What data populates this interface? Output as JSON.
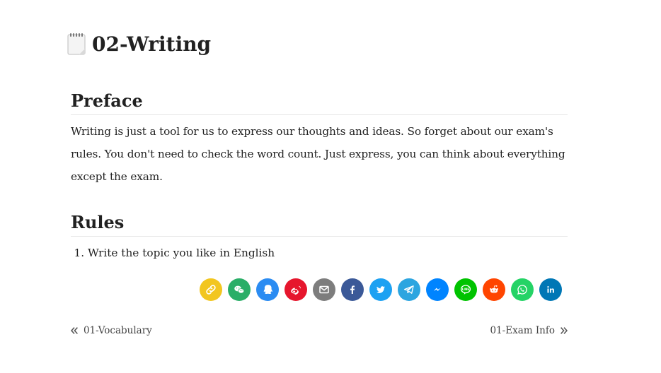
{
  "page": {
    "title": "02-Writing",
    "title_icon": "notepad-icon"
  },
  "sections": {
    "preface": {
      "heading": "Preface",
      "paragraph": "Writing is just a tool for us to express our thoughts and ideas. So forget about our exam's rules. You don't need to check the word count. Just express, you can think about everything except the exam."
    },
    "rules": {
      "heading": "Rules",
      "items": [
        "Write the topic you like in English"
      ]
    }
  },
  "share": {
    "buttons": [
      {
        "name": "copy-link",
        "icon": "link-icon",
        "color": "#f2c61f"
      },
      {
        "name": "wechat",
        "icon": "wechat-icon",
        "color": "#2aae67"
      },
      {
        "name": "qq",
        "icon": "qq-icon",
        "color": "#2b8cf2"
      },
      {
        "name": "weibo",
        "icon": "weibo-icon",
        "color": "#e6162d"
      },
      {
        "name": "email",
        "icon": "email-icon",
        "color": "#7d7d7d"
      },
      {
        "name": "facebook",
        "icon": "facebook-icon",
        "color": "#3b5998"
      },
      {
        "name": "twitter",
        "icon": "twitter-icon",
        "color": "#1da1f2"
      },
      {
        "name": "telegram",
        "icon": "telegram-icon",
        "color": "#2ca5e0"
      },
      {
        "name": "messenger",
        "icon": "messenger-icon",
        "color": "#0084ff"
      },
      {
        "name": "line",
        "icon": "line-icon",
        "color": "#00c300"
      },
      {
        "name": "reddit",
        "icon": "reddit-icon",
        "color": "#ff4500"
      },
      {
        "name": "whatsapp",
        "icon": "whatsapp-icon",
        "color": "#25d366"
      },
      {
        "name": "linkedin",
        "icon": "linkedin-icon",
        "color": "#0077b5"
      }
    ]
  },
  "navigation": {
    "prev_label": "01-Vocabulary",
    "next_label": "01-Exam Info"
  }
}
